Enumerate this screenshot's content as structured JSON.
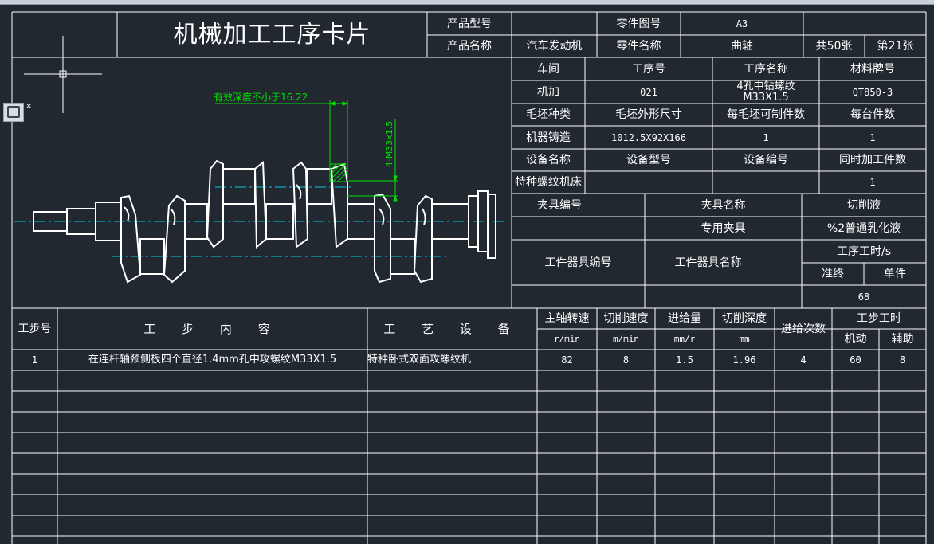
{
  "card": {
    "title": "机械加工工序卡片",
    "product_model_label": "产品型号",
    "product_model": "",
    "part_drawing_no_label": "零件图号",
    "part_drawing_no": "A3",
    "product_name_label": "产品名称",
    "product_name": "汽车发动机",
    "part_name_label": "零件名称",
    "part_name": "曲轴",
    "total_sheets": "共50张",
    "sheet_no": "第21张"
  },
  "drawing": {
    "depth_note": "有效深度不小于16.22",
    "thread_note": "4-M33x1.5"
  },
  "info": {
    "workshop_label": "车间",
    "op_no_label": "工序号",
    "op_name_label": "工序名称",
    "material_label": "材料牌号",
    "workshop": "机加",
    "op_no": "021",
    "op_name": "4孔中钻螺纹M33X1.5",
    "material": "QT850-3",
    "blank_type_label": "毛坯种类",
    "blank_size_label": "毛坯外形尺寸",
    "parts_per_blank_label": "每毛坯可制件数",
    "parts_per_unit_label": "每台件数",
    "blank_type": "机器铸造",
    "blank_size": "1012.5X92X166",
    "parts_per_blank": "1",
    "parts_per_unit": "1",
    "equip_name_label": "设备名称",
    "equip_model_label": "设备型号",
    "equip_no_label": "设备编号",
    "simul_parts_label": "同时加工件数",
    "equip_name": "特种螺纹机床",
    "equip_model": "",
    "equip_no": "",
    "simul_parts": "1",
    "fixture_no_label": "夹具编号",
    "fixture_name_label": "夹具名称",
    "coolant_label": "切削液",
    "fixture_no": "",
    "fixture_name": "专用夹具",
    "coolant": "%2普通乳化液",
    "station_tool_no_label": "工件器具编号",
    "station_tool_name_label": "工件器具名称",
    "op_time_label": "工序工时/s",
    "prep_end_label": "准终",
    "unit_label": "单件",
    "prep_end": "",
    "unit_time": "68"
  },
  "steps": {
    "headers": {
      "step_no": "工步号",
      "content": "工 步 内 容",
      "equipment": "工 艺 设 备",
      "spindle_speed": "主轴转速",
      "cutting_speed": "切削速度",
      "feed": "进给量",
      "cut_depth": "切削深度",
      "feed_passes": "进给次数",
      "step_time": "工步工时",
      "machine_time": "机动",
      "aux_time": "辅助"
    },
    "units": {
      "spindle_speed": "r/min",
      "cutting_speed": "m/min",
      "feed": "mm/r",
      "cut_depth": "mm"
    },
    "rows": [
      {
        "no": "1",
        "content": "在连杆轴颈侧板四个直径1.4mm孔中攻螺纹M33X1.5",
        "equipment": "特种卧式双面攻螺纹机",
        "spindle_speed": "82",
        "cutting_speed": "8",
        "feed": "1.5",
        "cut_depth": "1.96",
        "feed_passes": "4",
        "machine_time": "60",
        "aux_time": "8"
      }
    ]
  },
  "colors": {
    "background": "#212830",
    "lines": "#ffffff",
    "dimension": "#00e000",
    "centerline": "#00c8e0"
  }
}
